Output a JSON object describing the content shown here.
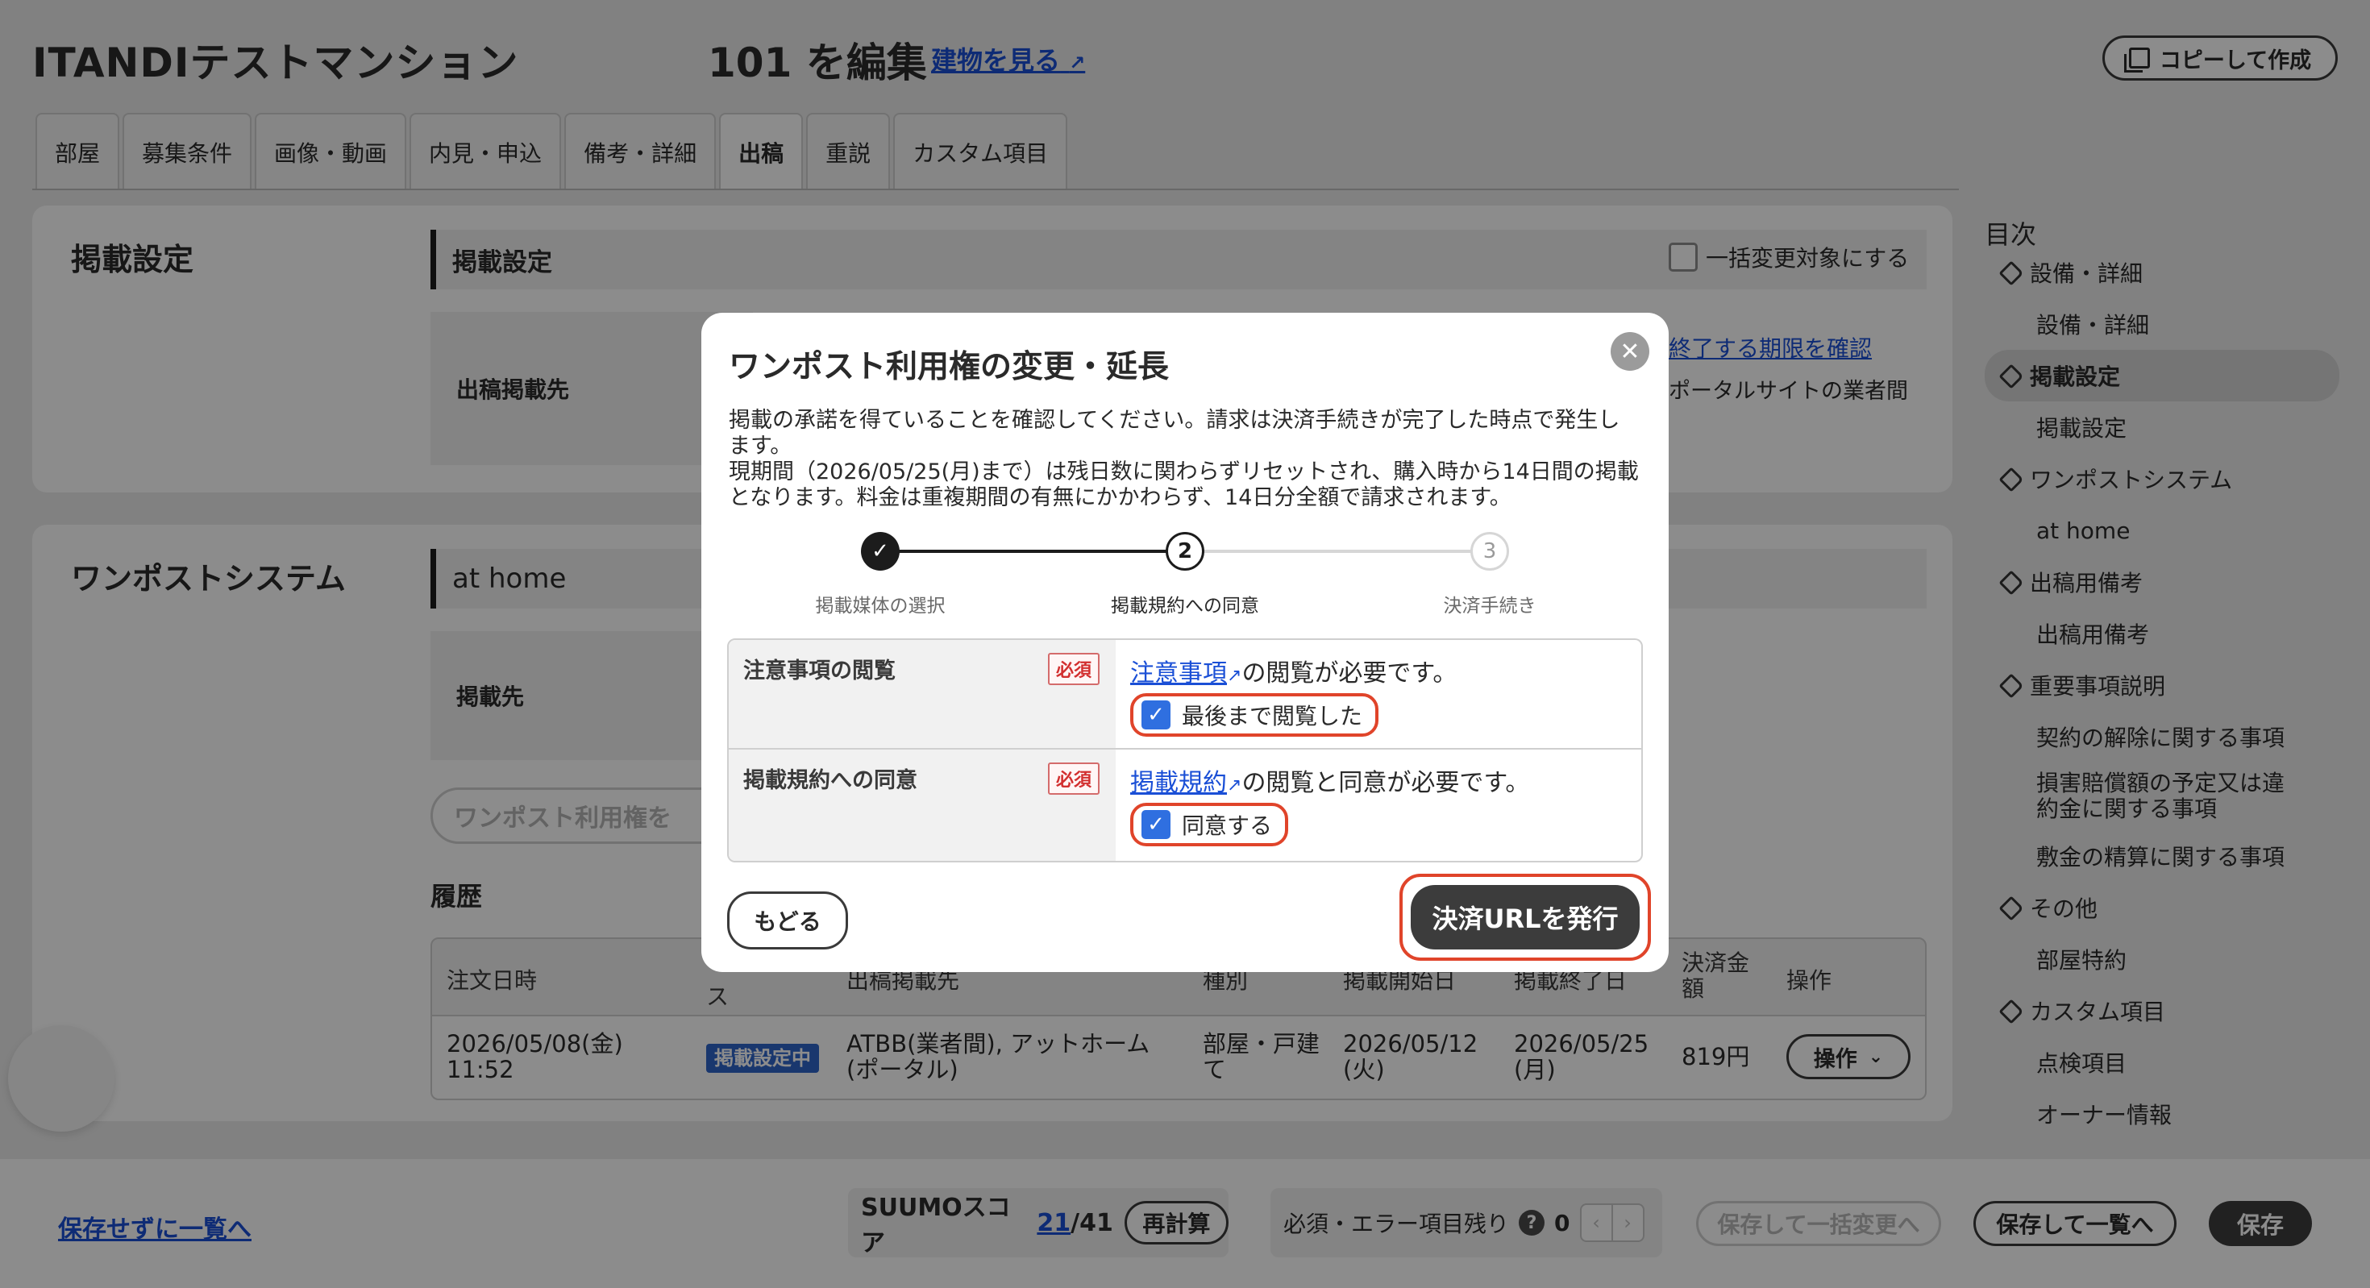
{
  "header": {
    "title": "ITANDIテストマンション",
    "edit_title": "101 を編集",
    "building_link": "建物を見る",
    "copy_button": "コピーして作成"
  },
  "tabs": [
    "部屋",
    "募集条件",
    "画像・動画",
    "内見・申込",
    "備考・詳細",
    "出稿",
    "重説",
    "カスタム項目"
  ],
  "active_tab": "出稿",
  "listing_settings": {
    "section_title": "掲載設定",
    "subhead": "掲載設定",
    "bulk_change_label": "一括変更対象にする",
    "row_label": "出稿掲載先",
    "expire_link": "終了する期限を確認",
    "portal_note": "ポータルサイトの業者間"
  },
  "onepost": {
    "section_title": "ワンポストシステム",
    "subhead": "at home",
    "row_label": "掲載先",
    "change_button_partial": "ワンポスト利用権を",
    "history_title": "履歴",
    "table_headers": [
      "注文日時",
      "ス",
      "出稿掲載先",
      "種別",
      "掲載開始日",
      "掲載終了日",
      "決済金額",
      "操作"
    ],
    "row": {
      "order_date": "2026/05/08(金) 11:52",
      "status": "掲載設定中",
      "destination": "ATBB(業者間), アットホーム(ポータル)",
      "type": "部屋・戸建て",
      "start": "2026/05/12 (火)",
      "end": "2026/05/25 (月)",
      "amount": "819円",
      "op_button": "操作"
    }
  },
  "toc": {
    "title": "目次",
    "items": [
      {
        "label": "設備・詳細",
        "level": "top"
      },
      {
        "label": "設備・詳細",
        "level": "sub"
      },
      {
        "label": "掲載設定",
        "level": "top",
        "active": true
      },
      {
        "label": "掲載設定",
        "level": "sub"
      },
      {
        "label": "ワンポストシステム",
        "level": "top"
      },
      {
        "label": "at home",
        "level": "sub"
      },
      {
        "label": "出稿用備考",
        "level": "top"
      },
      {
        "label": "出稿用備考",
        "level": "sub"
      },
      {
        "label": "重要事項説明",
        "level": "top"
      },
      {
        "label": "契約の解除に関する事項",
        "level": "sub"
      },
      {
        "label": "損害賠償額の予定又は違約金に関する事項",
        "level": "sub"
      },
      {
        "label": "敷金の精算に関する事項",
        "level": "sub"
      },
      {
        "label": "その他",
        "level": "top"
      },
      {
        "label": "部屋特約",
        "level": "sub"
      },
      {
        "label": "カスタム項目",
        "level": "top"
      },
      {
        "label": "点検項目",
        "level": "sub"
      },
      {
        "label": "オーナー情報",
        "level": "sub"
      }
    ]
  },
  "footer": {
    "save_exit": "保存せずに一覧へ",
    "score_label": "SUUMOスコア",
    "score_value": "21",
    "score_max": "/41",
    "recalc": "再計算",
    "remaining_label": "必須・エラー項目残り",
    "remaining_count": "0",
    "bulk_save": "保存して一括変更へ",
    "save_list": "保存して一覧へ",
    "save": "保存"
  },
  "modal": {
    "title": "ワンポスト利用権の変更・延長",
    "paragraph1": "掲載の承諾を得ていることを確認してください。請求は決済手続きが完了した時点で発生します。",
    "paragraph2": "現期間（2026/05/25(月)まで）は残日数に関わらずリセットされ、購入時から14日間の掲載となります。料金は重複期間の有無にかかわらず、14日分全額で請求されます。",
    "steps": [
      {
        "number": "1",
        "label": "掲載媒体の選択",
        "state": "done"
      },
      {
        "number": "2",
        "label": "掲載規約への同意",
        "state": "current"
      },
      {
        "number": "3",
        "label": "決済手続き",
        "state": "pending"
      }
    ],
    "rows": [
      {
        "label": "注意事項の閲覧",
        "required": "必須",
        "link": "注意事項",
        "text": "の閲覧が必要です。",
        "check_label": "最後まで閲覧した",
        "checked": true
      },
      {
        "label": "掲載規約への同意",
        "required": "必須",
        "link": "掲載規約",
        "text": "の閲覧と同意が必要です。",
        "check_label": "同意する",
        "checked": true
      }
    ],
    "back_button": "もどる",
    "issue_button": "決済URLを発行"
  },
  "colors": {
    "link": "#1a4fd6",
    "highlight": "#e0442a",
    "checkbox": "#2f6fe0",
    "status_tag": "#2f64c9"
  }
}
